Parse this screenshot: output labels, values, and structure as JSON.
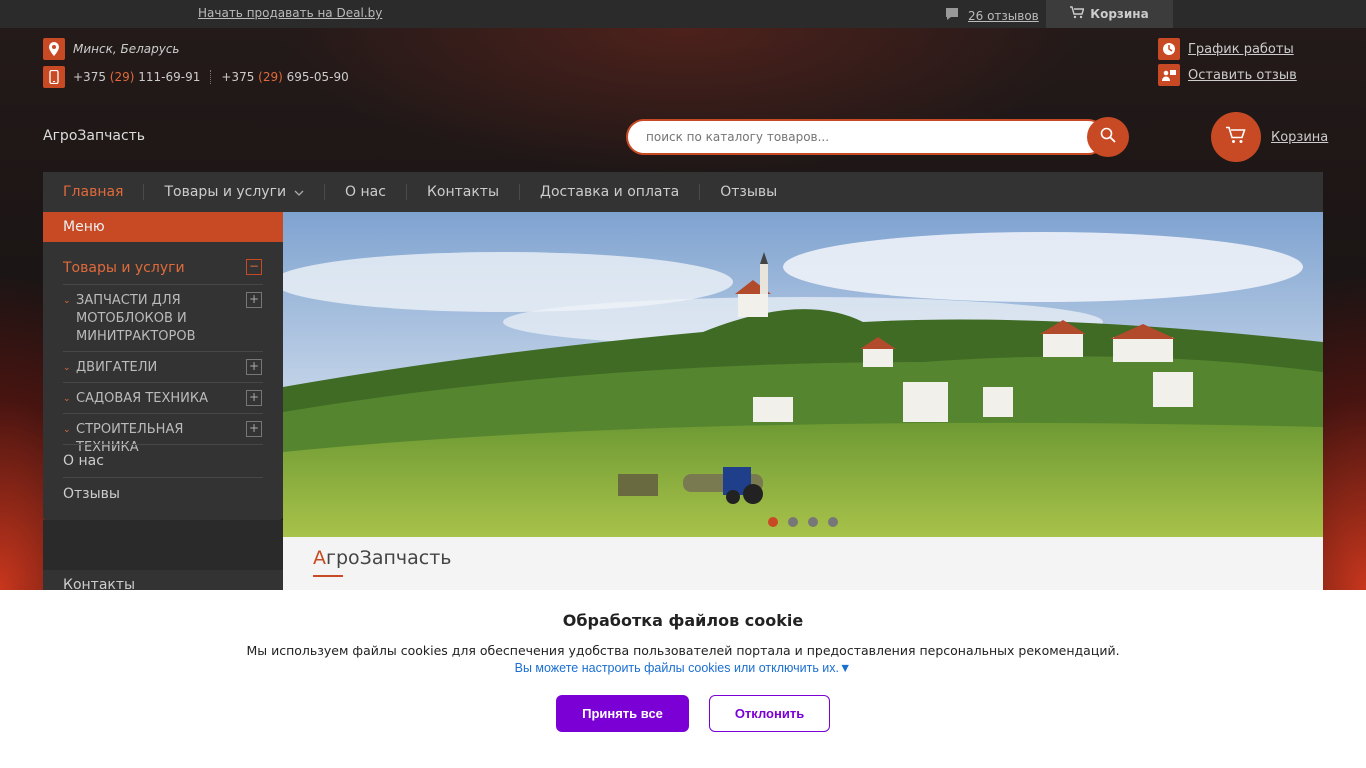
{
  "topbar": {
    "sell_link": "Начать продавать на Deal.by",
    "reviews_link": "26 отзывов",
    "cart_label": "Корзина"
  },
  "contacts": {
    "location": "Минск, Беларусь",
    "phone1_prefix": "+375",
    "phone1_code": "(29)",
    "phone1_number": "111-69-91",
    "phone2_prefix": "+375",
    "phone2_code": "(29)",
    "phone2_number": "695-05-90"
  },
  "header_links": {
    "schedule": "График работы",
    "leave_review": "Оставить отзыв"
  },
  "brand": "АгроЗапчасть",
  "search": {
    "placeholder": "поиск по каталогу товаров..."
  },
  "cart": {
    "label": "Корзина"
  },
  "nav": [
    {
      "label": "Главная"
    },
    {
      "label": "Товары и услуги"
    },
    {
      "label": "О нас"
    },
    {
      "label": "Контакты"
    },
    {
      "label": "Доставка и оплата"
    },
    {
      "label": "Отзывы"
    }
  ],
  "sidebar": {
    "title": "Меню",
    "section": "Товары и услуги",
    "collapse_symbol": "−",
    "expand_symbol": "+",
    "chevron": "⌄",
    "subitems": [
      {
        "label": "ЗАПЧАСТИ ДЛЯ МОТОБЛОКОВ И МИНИТРАКТОРОВ"
      },
      {
        "label": "ДВИГАТЕЛИ"
      },
      {
        "label": "САДОВАЯ ТЕХНИКА"
      },
      {
        "label": "СТРОИТЕЛЬНАЯ ТЕХНИКА"
      }
    ],
    "links": [
      {
        "label": "О нас"
      },
      {
        "label": "Отзывы"
      }
    ],
    "contacts_title": "Контакты"
  },
  "slider": {
    "slide_count": 4,
    "active_slide": 1
  },
  "content": {
    "title_first": "А",
    "title_rest": "гроЗапчасть"
  },
  "cookie": {
    "title": "Обработка файлов cookie",
    "text": "Мы используем файлы cookies для обеспечения удобства пользователей портала и предоставления персональных рекомендаций.",
    "settings_link": "Вы можете настроить файлы cookies или отключить их.▼",
    "accept": "Принять все",
    "decline": "Отклонить"
  },
  "colors": {
    "accent": "#c84a24",
    "nav_bg": "#333333",
    "cookie_button": "#7b00d6"
  }
}
